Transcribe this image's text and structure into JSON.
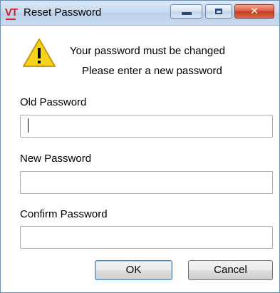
{
  "window": {
    "app_icon_text": "VT",
    "title": "Reset Password",
    "controls": {
      "minimize": "minimize",
      "maximize": "maximize",
      "close": "close"
    }
  },
  "message": {
    "icon": "warning-icon",
    "line1": "Your password must be changed",
    "line2": "Please enter a new password"
  },
  "fields": {
    "old_label": "Old Password",
    "old_value": "",
    "new_label": "New Password",
    "new_value": "",
    "confirm_label": "Confirm Password",
    "confirm_value": ""
  },
  "buttons": {
    "ok": "OK",
    "cancel": "Cancel"
  },
  "colors": {
    "warning": "#f6d31e",
    "close_button": "#d9573a"
  }
}
